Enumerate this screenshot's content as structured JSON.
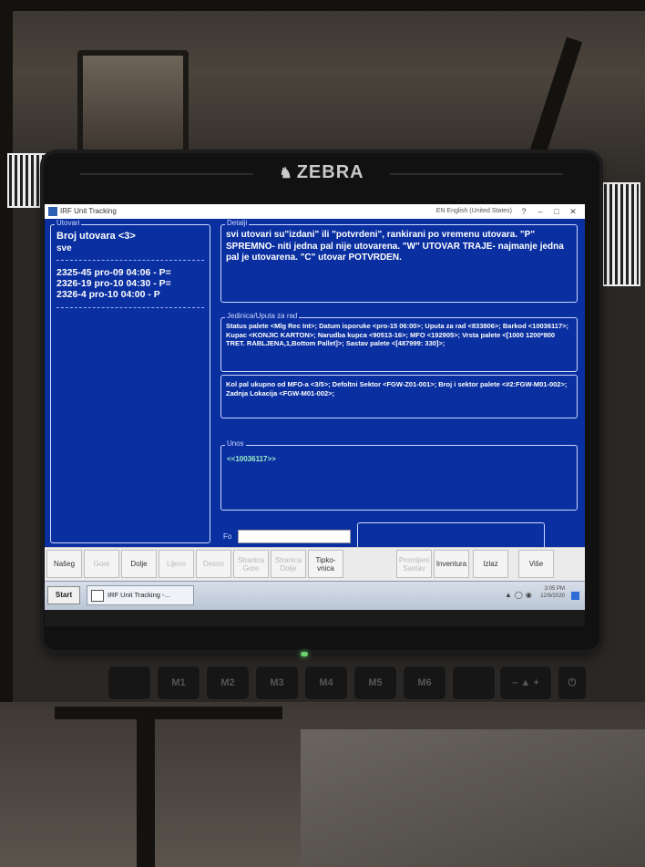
{
  "window": {
    "title": "IRF Unit Tracking",
    "language": "EN English (United States)",
    "controls": [
      "?",
      "–",
      "□",
      "✕"
    ]
  },
  "device": {
    "brand": "ZEBRA"
  },
  "utovari": {
    "legend": "Utovari",
    "count": "Broj utovara <3>",
    "filter": "sve",
    "items": [
      "2325-45 pro-09 04:06 - P=",
      "2326-19 pro-10 04:30 - P=",
      "2326-4 pro-10 04:00 - P"
    ]
  },
  "detalji": {
    "legend": "Detalji",
    "text": "svi utovari su\"izdani\" ili \"potvrdeni\", rankirani po vremenu utovara. \"P\" SPREMNO- niti jedna pal nije utovarena. \"W\" UTOVAR TRAJE- najmanje jedna pal je utovarena. \"C\" utovar POTVRDEN."
  },
  "jedinica": {
    "legend": "Jedinica/Uputa za rad",
    "text": "Status palete <Mlg Rec Int>; Datum isporuke <pro-15 06:00>; Uputa za rad <833806>; Barkod <10036117>; Kupac <KONJIC KARTON>; Narudba kupca <90513-16>; MFO <192905>; Vrsta palete <[1000 1200*800 TRET. RABLJENA,1,Bottom Pallet]>; Sastav palete <[487999: 330]>;"
  },
  "kol": {
    "text": "Kol pal ukupno od MFO-a <3/5>; Defoltni Sektor <FGW-Z01-001>; Broj i sektor palete <#2:FGW-M01-002>; Zadnja Lokacija <FGW-M01-002>;"
  },
  "unos": {
    "legend": "Unos",
    "value": "<<10036117>>"
  },
  "fo": {
    "label": "Fo",
    "value": ""
  },
  "toolbar": {
    "buttons": [
      {
        "label": "Našeg",
        "enabled": true
      },
      {
        "label": "Gore",
        "enabled": false
      },
      {
        "label": "Dolje",
        "enabled": true
      },
      {
        "label": "Lijevo",
        "enabled": false
      },
      {
        "label": "Desno",
        "enabled": false
      },
      {
        "label": "Stranica Gore",
        "enabled": false
      },
      {
        "label": "Stranica Dolje",
        "enabled": false
      },
      {
        "label": "Tipko-vnica",
        "enabled": true
      },
      {
        "label": "Promijeni Sastav",
        "enabled": false
      },
      {
        "label": "Inventura",
        "enabled": true
      },
      {
        "label": "Izlaz",
        "enabled": true
      },
      {
        "label": "Više",
        "enabled": true
      }
    ]
  },
  "taskbar": {
    "start": "Start",
    "task": "IRF Unit Tracking -...",
    "time": "3:05 PM",
    "date": "12/9/2020"
  },
  "hw_keys": [
    "M1",
    "M2",
    "M3",
    "M4",
    "M5",
    "M6"
  ]
}
